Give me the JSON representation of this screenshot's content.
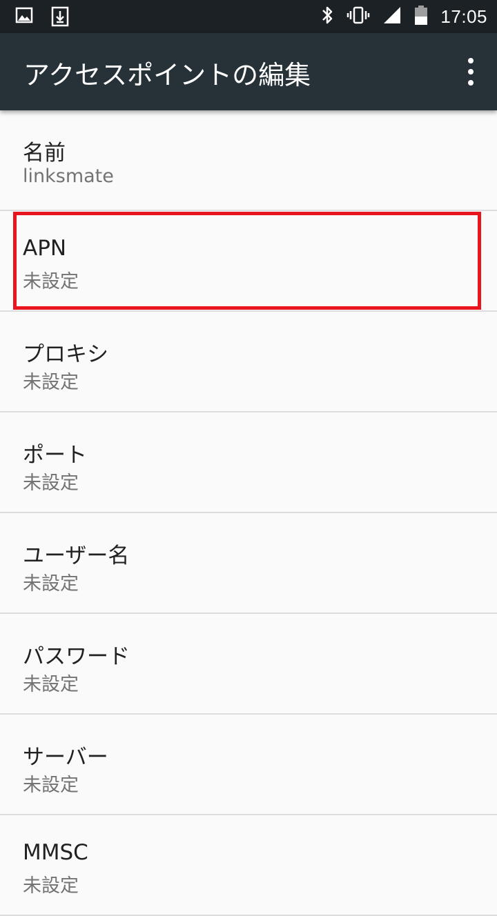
{
  "status_bar": {
    "time": "17:05",
    "icons": [
      "image-icon",
      "download-icon",
      "bluetooth-icon",
      "vibrate-icon",
      "signal-icon",
      "battery-icon"
    ]
  },
  "app_bar": {
    "title": "アクセスポイントの編集",
    "overflow_icon": "more-vert-icon"
  },
  "preferences": [
    {
      "title": "名前",
      "summary": "linksmate"
    },
    {
      "title": "APN",
      "summary": "未設定"
    },
    {
      "title": "プロキシ",
      "summary": "未設定"
    },
    {
      "title": "ポート",
      "summary": "未設定"
    },
    {
      "title": "ユーザー名",
      "summary": "未設定"
    },
    {
      "title": "パスワード",
      "summary": "未設定"
    },
    {
      "title": "サーバー",
      "summary": "未設定"
    },
    {
      "title": "MMSC",
      "summary": "未設定"
    }
  ],
  "highlight_color": "#e8151f",
  "colors": {
    "app_bar": "#263238",
    "status_bar": "#1b2125",
    "background": "#fafafa"
  }
}
